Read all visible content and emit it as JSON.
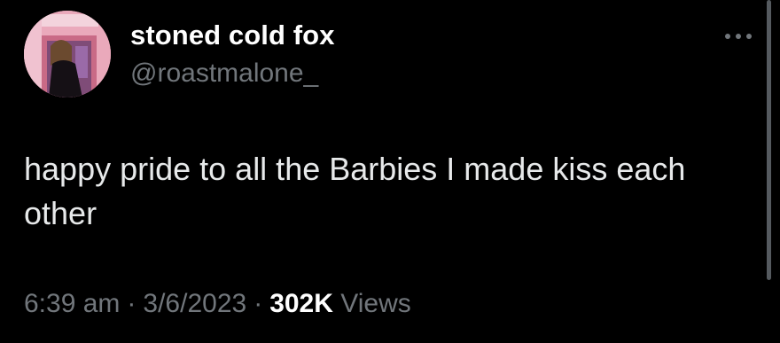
{
  "user": {
    "display_name": "stoned cold fox",
    "handle": "@roastmalone_"
  },
  "tweet": {
    "text": "happy pride to all the Barbies I made kiss each other"
  },
  "meta": {
    "time": "6:39 am",
    "separator": "·",
    "date": "3/6/2023",
    "views_count": "302K",
    "views_label": "Views"
  },
  "icons": {
    "more": "more-horizontal-icon"
  },
  "colors": {
    "background": "#000000",
    "primary_text": "#e7e9ea",
    "secondary_text": "#71767b"
  }
}
